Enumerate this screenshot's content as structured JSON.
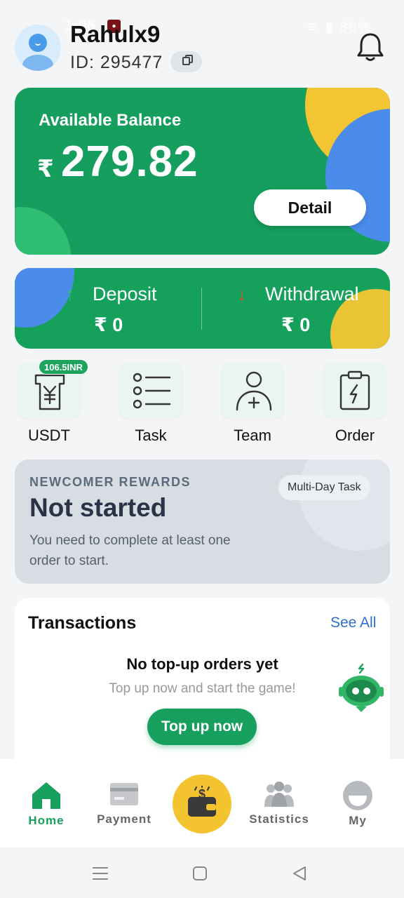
{
  "status_bar": {
    "time": "1:06",
    "battery": "86%"
  },
  "header": {
    "username": "Rahulx9",
    "id_label": "ID:",
    "id_value": "295477"
  },
  "balance": {
    "label": "Available Balance",
    "currency": "₹",
    "amount": "279.82",
    "detail_label": "Detail"
  },
  "deposit_withdraw": {
    "deposit_label": "Deposit",
    "deposit_value": "₹ 0",
    "withdraw_label": "Withdrawal",
    "withdraw_value": "₹ 0"
  },
  "quick_actions": {
    "usdt": {
      "label": "USDT",
      "badge": "106.5INR"
    },
    "task": {
      "label": "Task"
    },
    "team": {
      "label": "Team"
    },
    "order": {
      "label": "Order"
    }
  },
  "rewards": {
    "kicker": "NEWCOMER REWARDS",
    "tag": "Multi-Day Task",
    "title": "Not started",
    "description": "You need to complete at least one order to start."
  },
  "transactions": {
    "title": "Transactions",
    "see_all": "See All",
    "empty_title": "No top-up orders yet",
    "empty_sub": "Top up now and start the game!",
    "topup_label": "Top up now"
  },
  "bottom_nav": {
    "home": "Home",
    "payment": "Payment",
    "statistics": "Statistics",
    "my": "My"
  },
  "colors": {
    "brand_green": "#17a05d",
    "accent_yellow": "#f4c430",
    "accent_blue": "#4b8cea"
  }
}
